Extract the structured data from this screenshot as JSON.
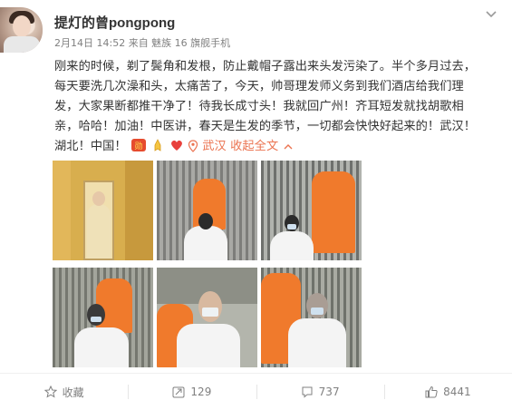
{
  "post": {
    "nickname": "提灯的曾pongpong",
    "meta": "2月14日 14:52 来自 魅族 16 旗舰手机",
    "content_lines": [
      "刚来的时候，剃了鬓角和发根，防止戴帽子露出来头发污染了。半个多月过去，",
      "每天要洗几次澡和头，太痛苦了，今天，帅哥理发师义务到我们酒店给我们理",
      "发，大家果断都推干净了！待我长成寸头！我就回广州！齐耳短发就找胡歌相",
      "亲，哈哈！加油！中医讲，春天是生发的季节，一切都会快快好起来的！武汉！"
    ],
    "last_line_prefix": "湖北！中国！",
    "location": "武汉",
    "expand_label": "收起全文",
    "icons": [
      "chevron-down-icon",
      "emoji-fight-icon",
      "emoji-praying-icon",
      "emoji-heart-icon",
      "location-pin-icon",
      "collapse-arrow-icon",
      "star-icon",
      "forward-icon",
      "comment-icon",
      "like-icon"
    ]
  },
  "actions": {
    "favorite_label": "收藏",
    "forward_count": "129",
    "comment_count": "737",
    "like_count": "8441"
  },
  "colors": {
    "link": "#eb7350",
    "meta": "#808080",
    "text": "#333333",
    "heart": "#e8403c"
  }
}
